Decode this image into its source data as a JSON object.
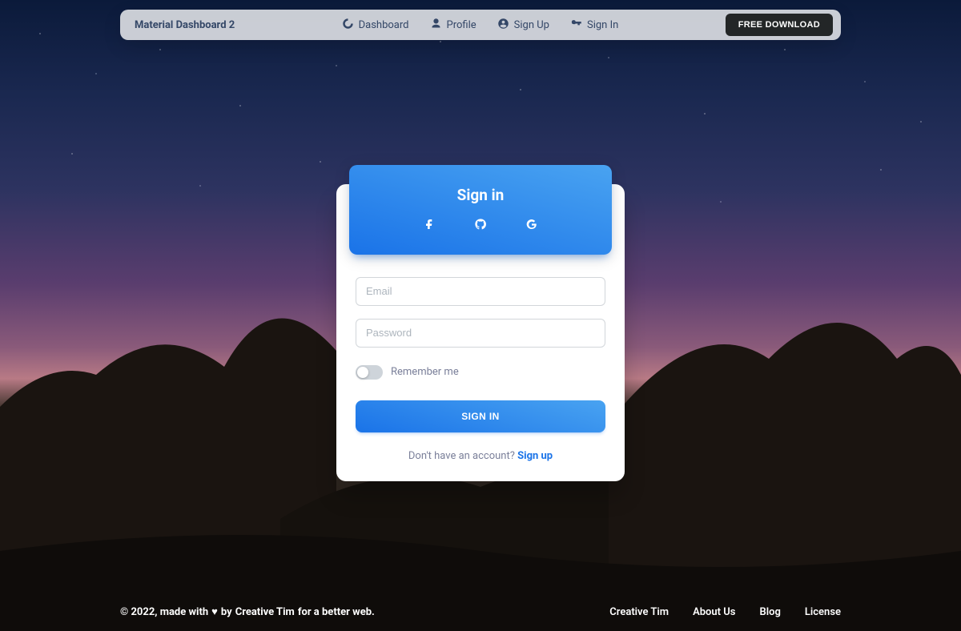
{
  "nav": {
    "brand": "Material Dashboard 2",
    "links": [
      {
        "label": "Dashboard"
      },
      {
        "label": "Profile"
      },
      {
        "label": "Sign Up"
      },
      {
        "label": "Sign In"
      }
    ],
    "cta": "FREE DOWNLOAD"
  },
  "card": {
    "title": "Sign in",
    "social": {
      "facebook": "facebook-icon",
      "github": "github-icon",
      "google": "google-icon"
    },
    "email_placeholder": "Email",
    "password_placeholder": "Password",
    "remember_label": "Remember me",
    "submit_label": "SIGN IN",
    "signup_prompt": "Don't have an account? ",
    "signup_link": "Sign up"
  },
  "footer": {
    "copyright_prefix": "© 2022, made with ",
    "copyright_mid": " by ",
    "author": "Creative Tim",
    "copyright_suffix": " for a better web.",
    "links": [
      {
        "label": "Creative Tim"
      },
      {
        "label": "About Us"
      },
      {
        "label": "Blog"
      },
      {
        "label": "License"
      }
    ]
  }
}
